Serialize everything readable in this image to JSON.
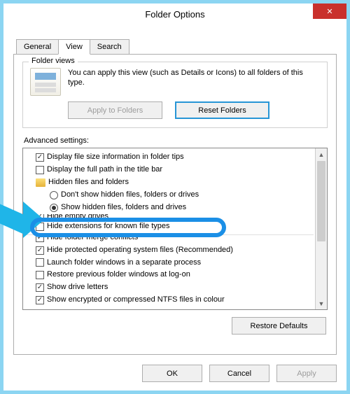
{
  "window": {
    "title": "Folder Options"
  },
  "tabs": {
    "general": "General",
    "view": "View",
    "search": "Search"
  },
  "folderViews": {
    "title": "Folder views",
    "text": "You can apply this view (such as Details or Icons) to all folders of this type.",
    "applyBtn": "Apply to Folders",
    "resetBtn": "Reset Folders"
  },
  "advanced": {
    "label": "Advanced settings:",
    "items": [
      {
        "type": "cb",
        "checked": true,
        "label": "Display file size information in folder tips"
      },
      {
        "type": "cb",
        "checked": false,
        "label": "Display the full path in the title bar"
      },
      {
        "type": "hdr",
        "label": "Hidden files and folders"
      },
      {
        "type": "rb",
        "checked": false,
        "label": "Don't show hidden files, folders or drives"
      },
      {
        "type": "rb",
        "checked": true,
        "label": "Show hidden files, folders and drives"
      },
      {
        "type": "cb",
        "checked": true,
        "label": "Hide empty drives",
        "cutoff": true
      },
      {
        "type": "cb",
        "checked": false,
        "label": "Hide extensions for known file types",
        "highlight": true
      },
      {
        "type": "cb",
        "checked": true,
        "label": "Hide folder merge conflicts",
        "cutoff_above": true
      },
      {
        "type": "cb",
        "checked": true,
        "label": "Hide protected operating system files (Recommended)"
      },
      {
        "type": "cb",
        "checked": false,
        "label": "Launch folder windows in a separate process"
      },
      {
        "type": "cb",
        "checked": false,
        "label": "Restore previous folder windows at log-on"
      },
      {
        "type": "cb",
        "checked": true,
        "label": "Show drive letters"
      },
      {
        "type": "cb",
        "checked": true,
        "label": "Show encrypted or compressed NTFS files in colour"
      }
    ],
    "restoreDefaults": "Restore Defaults"
  },
  "footer": {
    "ok": "OK",
    "cancel": "Cancel",
    "apply": "Apply"
  }
}
